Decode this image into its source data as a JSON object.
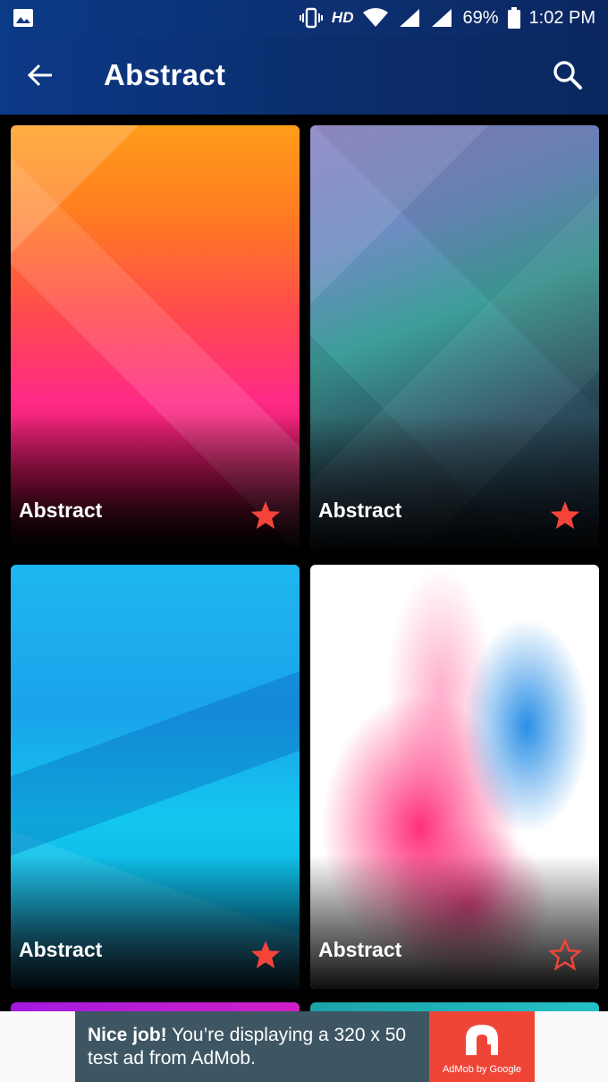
{
  "status_bar": {
    "hd_label": "HD",
    "battery_percent": "69%",
    "time": "1:02 PM",
    "icons": [
      "image-icon",
      "vibrate-icon",
      "wifi-icon",
      "signal-icon",
      "signal-icon",
      "battery-icon"
    ]
  },
  "app_bar": {
    "title": "Abstract",
    "back_icon": "arrow-left-icon",
    "search_icon": "search-icon"
  },
  "wallpapers": [
    {
      "label": "Abstract",
      "favorite": true
    },
    {
      "label": "Abstract",
      "favorite": true
    },
    {
      "label": "Abstract",
      "favorite": true
    },
    {
      "label": "Abstract",
      "favorite": false
    }
  ],
  "ad": {
    "headline": "Nice job!",
    "body": "You’re displaying a 320 x 50 test ad from AdMob.",
    "brand": "AdMob by Google"
  },
  "colors": {
    "app_bar": "#0c3988",
    "star_filled": "#f4443a",
    "ad_background": "#3e5664",
    "ad_logo": "#ef4537"
  }
}
